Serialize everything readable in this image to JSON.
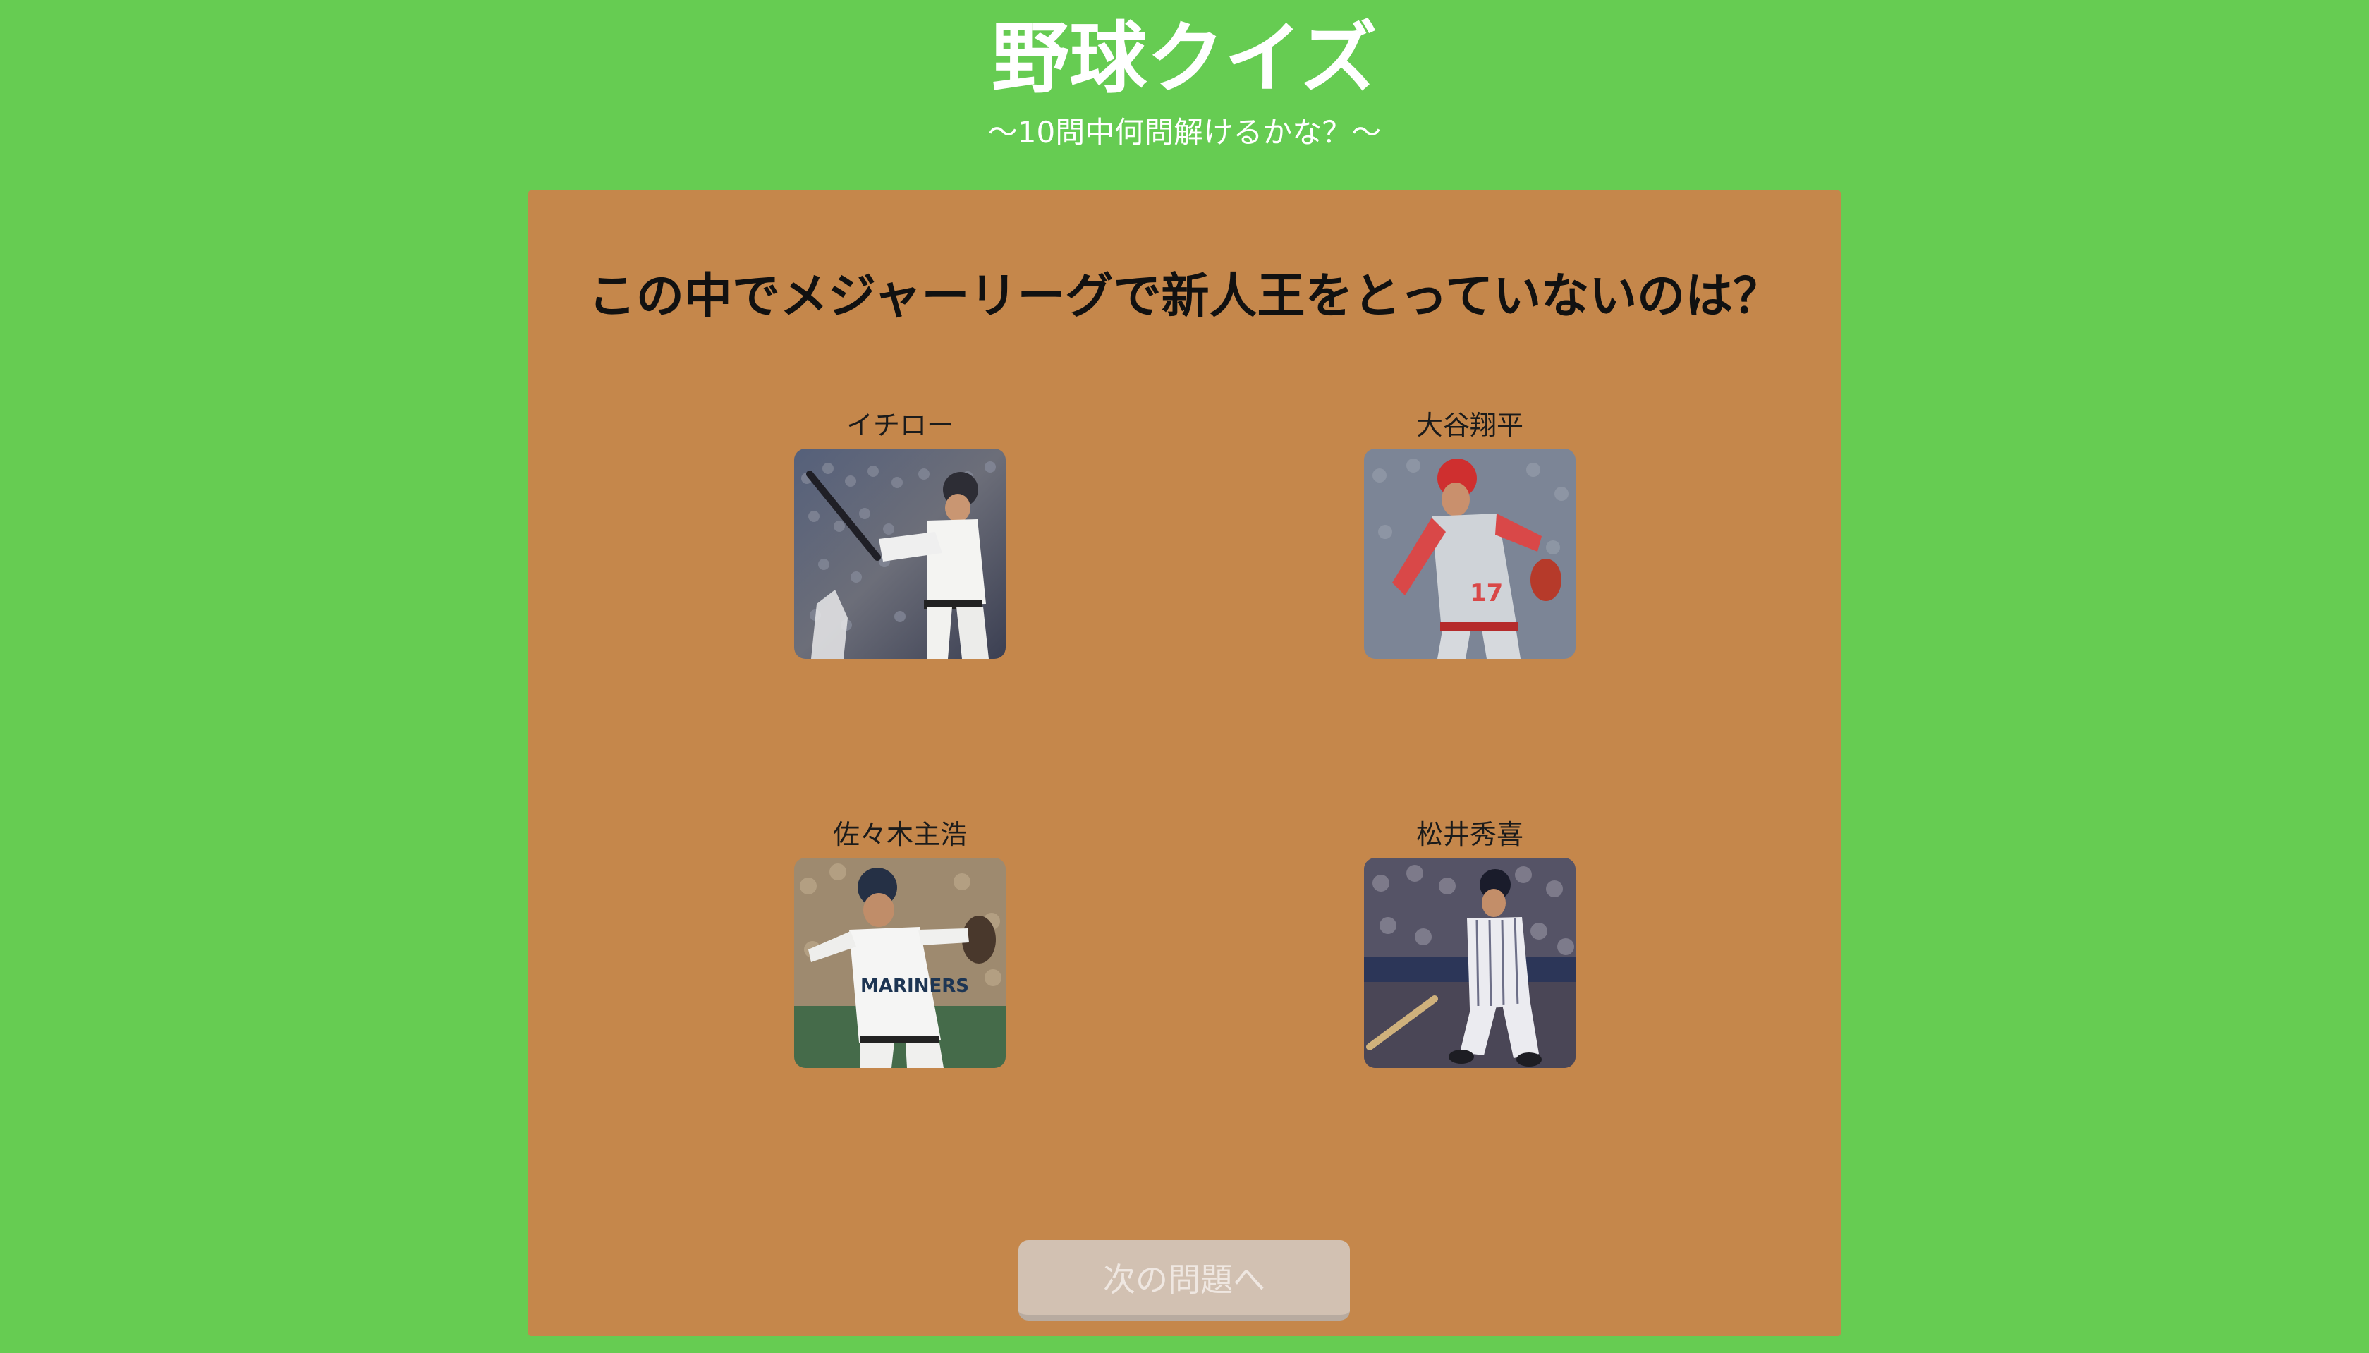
{
  "header": {
    "title": "野球クイズ",
    "subtitle": "〜10問中何問解けるかな？〜"
  },
  "quiz": {
    "question": "この中でメジャーリーグで新人王をとっていないのは？",
    "options": [
      {
        "label": "イチロー",
        "photo_icon": "baseball-batter-photo"
      },
      {
        "label": "大谷翔平",
        "photo_icon": "baseball-pitcher-photo"
      },
      {
        "label": "佐々木主浩",
        "photo_icon": "baseball-pitcher-photo"
      },
      {
        "label": "松井秀喜",
        "photo_icon": "baseball-batter-photo"
      }
    ],
    "next_button": "次の問題へ"
  },
  "colors": {
    "background": "#66cc52",
    "panel": "#c5874b",
    "button": "#d2c1b2"
  }
}
